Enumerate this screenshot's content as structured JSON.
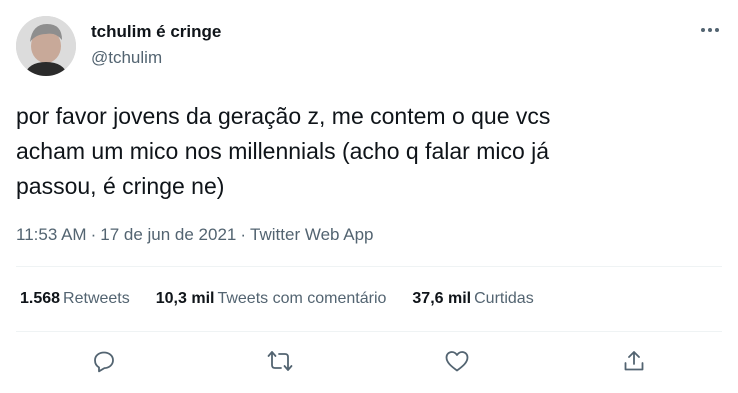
{
  "author": {
    "name": "tchulim é cringe",
    "handle": "@tchulim"
  },
  "tweet": {
    "text_lines": [
      "por favor jovens da geração z, me contem o que vcs",
      "acham um mico nos millennials (acho q falar mico já",
      "passou, é cringe ne)"
    ],
    "time": "11:53 AM",
    "date": "17 de jun de 2021",
    "source": "Twitter Web App",
    "separator": "·"
  },
  "stats": {
    "retweets_count": "1.568",
    "retweets_label": "Retweets",
    "quotes_count": "10,3 mil",
    "quotes_label": "Tweets com comentário",
    "likes_count": "37,6 mil",
    "likes_label": "Curtidas"
  },
  "icons": {
    "more": "more-horizontal-icon",
    "reply": "reply-bubble-icon",
    "retweet": "retweet-icon",
    "like": "heart-icon",
    "share": "share-icon"
  },
  "colors": {
    "text": "#0f1419",
    "secondary": "#536471",
    "divider": "#eff3f4"
  }
}
